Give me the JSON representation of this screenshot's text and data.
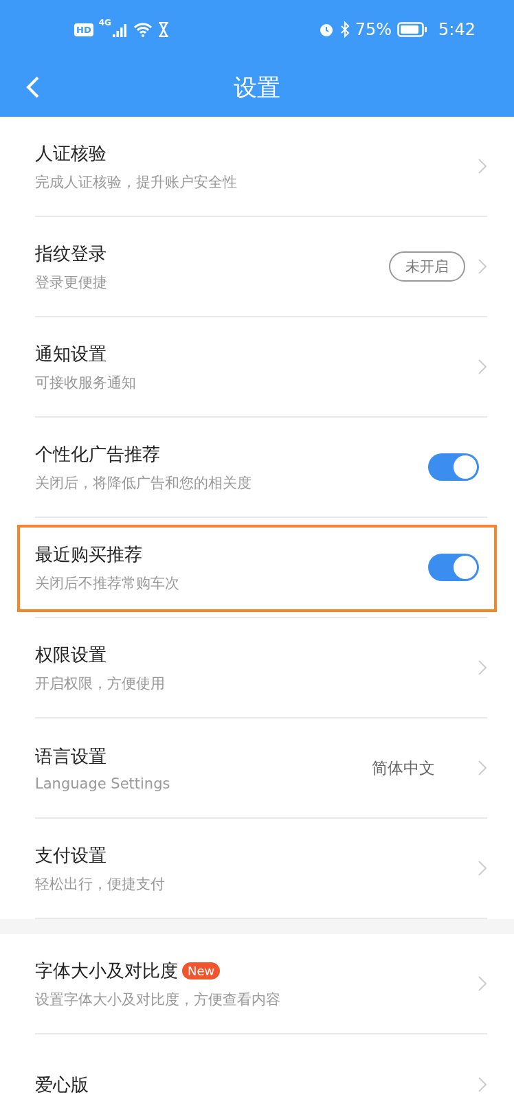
{
  "status_bar": {
    "network_badge": "HD",
    "network_type": "4G",
    "battery": "75%",
    "time": "5:42"
  },
  "header": {
    "title": "设置"
  },
  "groups": [
    {
      "items": [
        {
          "kind": "link",
          "title": "人证核验",
          "subtitle": "完成人证核验，提升账户安全性",
          "highlighted": false
        },
        {
          "kind": "status",
          "title": "指纹登录",
          "subtitle": "登录更便捷",
          "status": "未开启",
          "highlighted": false
        },
        {
          "kind": "link",
          "title": "通知设置",
          "subtitle": "可接收服务通知",
          "highlighted": false
        },
        {
          "kind": "toggle",
          "title": "个性化广告推荐",
          "subtitle": "关闭后，将降低广告和您的相关度",
          "on": true,
          "highlighted": false
        },
        {
          "kind": "toggle",
          "title": "最近购买推荐",
          "subtitle": "关闭后不推荐常购车次",
          "on": true,
          "highlighted": true
        },
        {
          "kind": "link",
          "title": "权限设置",
          "subtitle": "开启权限，方便使用",
          "highlighted": false
        },
        {
          "kind": "value",
          "title": "语言设置",
          "subtitle": "Language Settings",
          "value": "简体中文",
          "highlighted": false
        },
        {
          "kind": "link",
          "title": "支付设置",
          "subtitle": "轻松出行，便捷支付",
          "highlighted": false
        }
      ]
    },
    {
      "items": [
        {
          "kind": "link",
          "title": "字体大小及对比度",
          "tag": "New",
          "subtitle": "设置字体大小及对比度，方便查看内容",
          "highlighted": false
        },
        {
          "kind": "link",
          "title": "爱心版",
          "highlighted": false
        }
      ]
    }
  ]
}
